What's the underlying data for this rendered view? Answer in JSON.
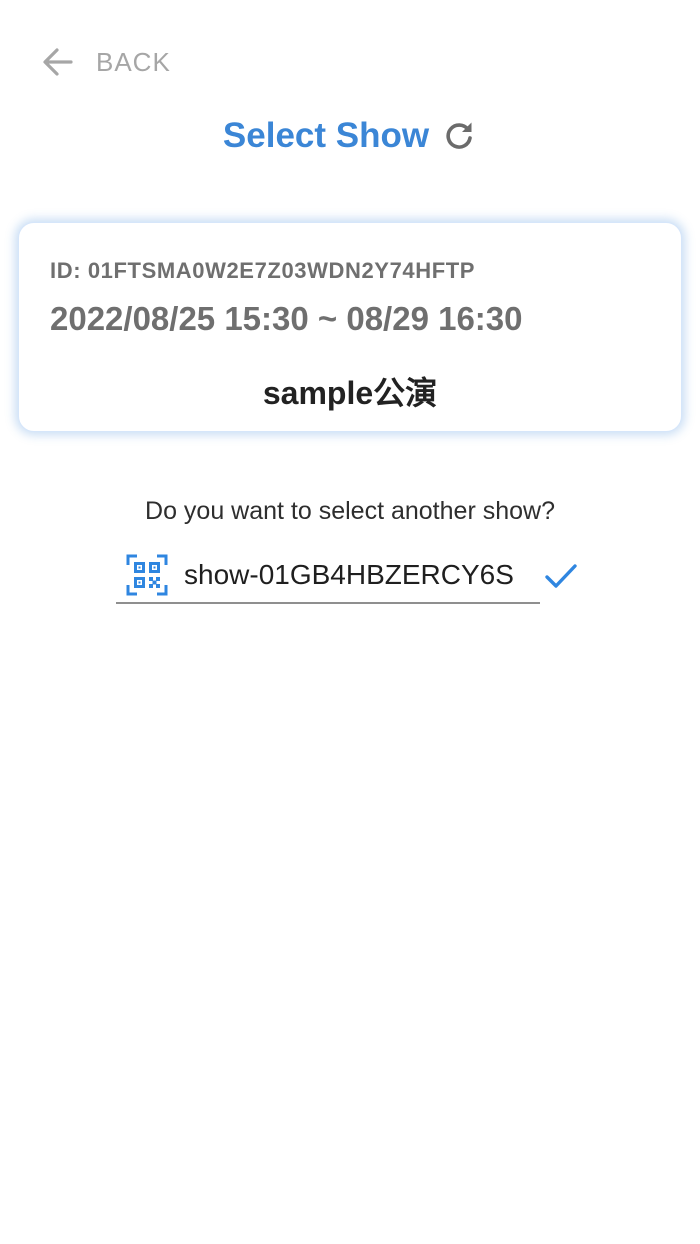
{
  "header": {
    "back_label": "BACK",
    "title": "Select Show",
    "back_icon": "arrow-left-icon",
    "refresh_icon": "refresh-icon"
  },
  "show_card": {
    "id_line": "ID: 01FTSMA0W2E7Z03WDN2Y74HFTP",
    "period": "2022/08/25 15:30 ~ 08/29 16:30",
    "name": "sample公演"
  },
  "change_show": {
    "question": "Do you want to select another show?",
    "input_value": "show-01GB4HBZERCY6S",
    "qr_icon": "qr-code-icon",
    "confirm_icon": "checkmark-icon"
  },
  "colors": {
    "accent": "#3b86d6",
    "muted": "#a6a6a6",
    "card_text": "#6f6f6f"
  }
}
